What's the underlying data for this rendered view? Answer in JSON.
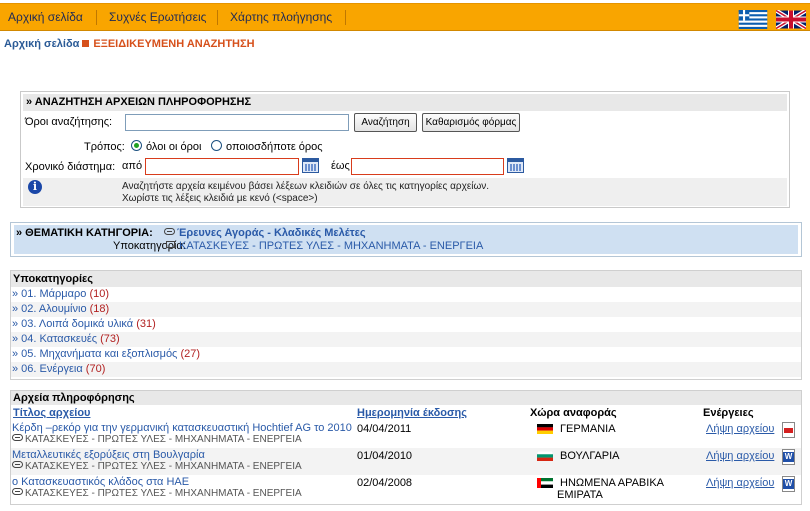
{
  "nav": {
    "items": [
      "Αρχική σελίδα",
      "Συχνές Ερωτήσεις",
      "Χάρτης πλοήγησης"
    ],
    "flags": [
      "greek-flag",
      "uk-flag"
    ]
  },
  "breadcrumb": {
    "home": "Αρχική σελίδα",
    "current": "ΕΞΕΙΔΙΚΕΥΜΕΝΗ ΑΝΑΖΗΤΗΣΗ"
  },
  "search": {
    "title": "» ΑΝΑΖΗΤΗΣΗ ΑΡΧΕΙΩΝ ΠΛΗΡΟΦΟΡΗΣΗΣ",
    "terms_label": "Όροι αναζήτησης:",
    "terms_value": "",
    "search_button": "Αναζήτηση",
    "clear_button": "Καθαρισμός φόρμας",
    "mode_label": "Τρόπος:",
    "mode_all": "όλοι οι όροι",
    "mode_any": "οποιοσδήποτε όρος",
    "mode_selected": "all",
    "period_label": "Χρονικό διάστημα:",
    "from_label": "από",
    "to_label": "έως",
    "from_value": "",
    "to_value": "",
    "help_line1": "Αναζητήστε αρχεία κειμένου βάσει λέξεων κλειδιών σε όλες τις κατηγορίες αρχείων.",
    "help_line2": "Χωρίστε τις λέξεις κλειδιά με κενό (<space>)"
  },
  "category": {
    "label": "» ΘΕΜΑΤΙΚΗ ΚΑΤΗΓΟΡΙΑ:",
    "value": "Έρευνες Αγοράς - Κλαδικές Μελέτες",
    "sub_label": "Υποκατηγορία:",
    "sub_value": "ΚΑΤΑΣΚΕΥΕΣ - ΠΡΩΤΕΣ ΥΛΕΣ - ΜΗΧΑΝΗΜΑΤΑ - ΕΝΕΡΓΕΙΑ"
  },
  "subcategories": {
    "title": "Υποκατηγορίες",
    "items": [
      {
        "label": "» 01. Μάρμαρο",
        "count": "(10)"
      },
      {
        "label": "» 02. Αλουμίνιο",
        "count": "(18)"
      },
      {
        "label": "» 03. Λοιπά δομικά υλικά",
        "count": "(31)"
      },
      {
        "label": "» 04. Κατασκευές",
        "count": "(73)"
      },
      {
        "label": "» 05. Μηχανήματα και εξοπλισμός",
        "count": "(27)"
      },
      {
        "label": "» 06. Ενέργεια",
        "count": "(70)"
      }
    ]
  },
  "files": {
    "title": "Αρχεία πληροφόρησης",
    "col_title": "Τίτλος αρχείου",
    "col_date": "Ημερομηνία έκδοσης",
    "col_country": "Χώρα αναφοράς",
    "col_actions": "Ενέργειες",
    "rows": [
      {
        "title": "Κέρδη –ρεκόρ για την γερμανική κατασκευαστική Hochtief AG το 2010",
        "category": "ΚΑΤΑΣΚΕΥΕΣ - ΠΡΩΤΕΣ ΥΛΕΣ - ΜΗΧΑΝΗΜΑΤΑ - ΕΝΕΡΓΕΙΑ",
        "date": "04/04/2011",
        "country": "ΓΕΡΜΑΝΙΑ",
        "country2": "",
        "flag": "germany-flag",
        "action": "Λήψη αρχείου",
        "file_icon": "pdf-icon"
      },
      {
        "title": "Μεταλλευτικές εξορύξεις στη Βουλγαρία",
        "category": "ΚΑΤΑΣΚΕΥΕΣ - ΠΡΩΤΕΣ ΥΛΕΣ - ΜΗΧΑΝΗΜΑΤΑ - ΕΝΕΡΓΕΙΑ",
        "date": "01/04/2010",
        "country": "ΒΟΥΛΓΑΡΙΑ",
        "country2": "",
        "flag": "bulgaria-flag",
        "action": "Λήψη αρχείου",
        "file_icon": "word-icon"
      },
      {
        "title": "ο Κατασκευαστικός κλάδος στα ΗΑΕ",
        "category": "ΚΑΤΑΣΚΕΥΕΣ - ΠΡΩΤΕΣ ΥΛΕΣ - ΜΗΧΑΝΗΜΑΤΑ - ΕΝΕΡΓΕΙΑ",
        "date": "02/04/2008",
        "country": "ΗΝΩΜΕΝΑ ΑΡΑΒΙΚΑ",
        "country2": "ΕΜΙΡΑΤΑ",
        "flag": "uae-flag",
        "action": "Λήψη αρχείου",
        "file_icon": "word-icon"
      }
    ]
  },
  "colors": {
    "nav_bg": "#f9a500",
    "link": "#2a5aa8",
    "accent": "#d6501b",
    "count": "#b22121"
  }
}
